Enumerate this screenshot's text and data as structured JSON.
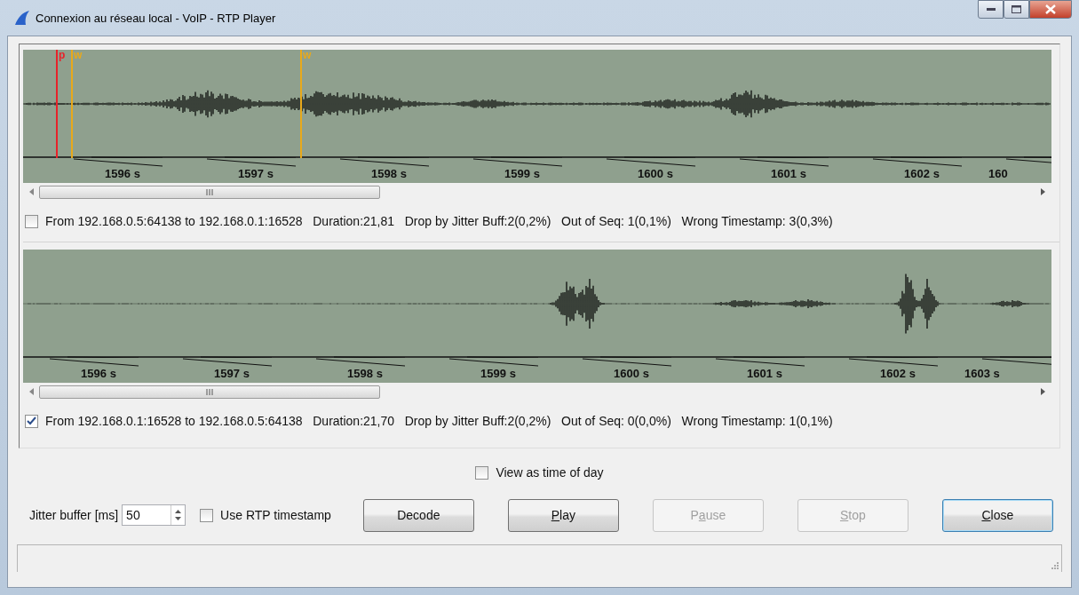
{
  "window": {
    "title": "Connexion au réseau local - VoIP - RTP Player"
  },
  "tracks": [
    {
      "markers": [
        {
          "label": "p",
          "kind": "play"
        },
        {
          "label": "w",
          "kind": "wait"
        },
        {
          "label": "w",
          "kind": "wait"
        }
      ],
      "time_labels": [
        "1596 s",
        "1597 s",
        "1598 s",
        "1599 s",
        "1600 s",
        "1601 s",
        "1602 s",
        "160"
      ],
      "checked": false,
      "info": "From 192.168.0.5:64138 to 192.168.0.1:16528   Duration:21,81   Drop by Jitter Buff:2(0,2%)   Out of Seq: 1(0,1%)   Wrong Timestamp: 3(0,3%)"
    },
    {
      "time_labels": [
        "1596 s",
        "1597 s",
        "1598 s",
        "1599 s",
        "1600 s",
        "1601 s",
        "1602 s",
        "1603 s"
      ],
      "checked": true,
      "info": "From 192.168.0.1:16528 to 192.168.0.5:64138   Duration:21,70   Drop by Jitter Buff:2(0,2%)   Out of Seq: 0(0,0%)   Wrong Timestamp: 1(0,1%)"
    }
  ],
  "view_time_of_day": {
    "label": "View as time of day",
    "checked": false
  },
  "jitter_buffer": {
    "label": "Jitter buffer [ms]",
    "value": "50"
  },
  "use_rtp_timestamp": {
    "label": "Use RTP timestamp",
    "checked": false
  },
  "buttons": [
    {
      "before": "Decode",
      "disabled": false,
      "default": false
    },
    {
      "key": "P",
      "after": "lay",
      "disabled": false,
      "default": false
    },
    {
      "before": "P",
      "key": "a",
      "after": "use",
      "disabled": true,
      "default": false
    },
    {
      "key": "S",
      "after": "top",
      "disabled": true,
      "default": false
    },
    {
      "key": "C",
      "after": "lose",
      "disabled": false,
      "default": true
    }
  ]
}
